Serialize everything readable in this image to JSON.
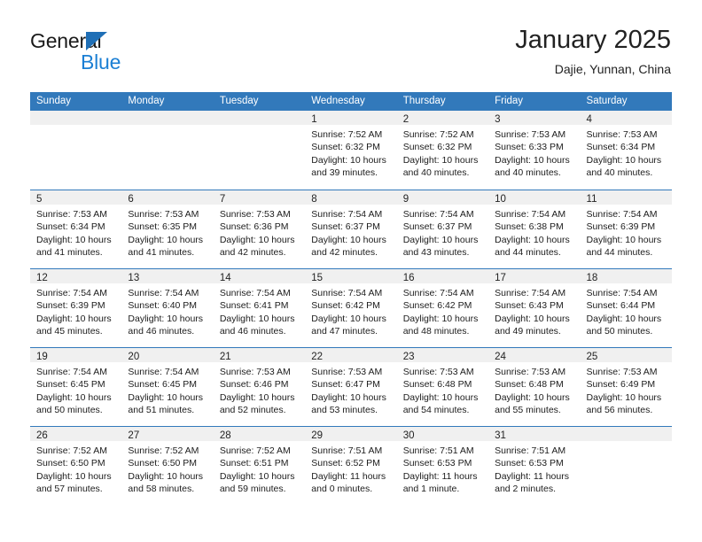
{
  "brand": {
    "name_top": "General",
    "name_bottom": "Blue",
    "triangle_color": "#1f6fb6",
    "blue_color": "#1b7fd4"
  },
  "header": {
    "title": "January 2025",
    "subtitle": "Dajie, Yunnan, China"
  },
  "theme": {
    "header_band": "#3279bb",
    "day_band": "#f0f0f0",
    "week_divider": "#3279bb"
  },
  "weekday_headers": [
    "Sunday",
    "Monday",
    "Tuesday",
    "Wednesday",
    "Thursday",
    "Friday",
    "Saturday"
  ],
  "weeks": [
    [
      {
        "day": "",
        "empty": true,
        "sunrise": "",
        "sunset": "",
        "daylight_line1": "",
        "daylight_line2": ""
      },
      {
        "day": "",
        "empty": true,
        "sunrise": "",
        "sunset": "",
        "daylight_line1": "",
        "daylight_line2": ""
      },
      {
        "day": "",
        "empty": true,
        "sunrise": "",
        "sunset": "",
        "daylight_line1": "",
        "daylight_line2": ""
      },
      {
        "day": "1",
        "sunrise": "Sunrise: 7:52 AM",
        "sunset": "Sunset: 6:32 PM",
        "daylight_line1": "Daylight: 10 hours",
        "daylight_line2": "and 39 minutes."
      },
      {
        "day": "2",
        "sunrise": "Sunrise: 7:52 AM",
        "sunset": "Sunset: 6:32 PM",
        "daylight_line1": "Daylight: 10 hours",
        "daylight_line2": "and 40 minutes."
      },
      {
        "day": "3",
        "sunrise": "Sunrise: 7:53 AM",
        "sunset": "Sunset: 6:33 PM",
        "daylight_line1": "Daylight: 10 hours",
        "daylight_line2": "and 40 minutes."
      },
      {
        "day": "4",
        "sunrise": "Sunrise: 7:53 AM",
        "sunset": "Sunset: 6:34 PM",
        "daylight_line1": "Daylight: 10 hours",
        "daylight_line2": "and 40 minutes."
      }
    ],
    [
      {
        "day": "5",
        "sunrise": "Sunrise: 7:53 AM",
        "sunset": "Sunset: 6:34 PM",
        "daylight_line1": "Daylight: 10 hours",
        "daylight_line2": "and 41 minutes."
      },
      {
        "day": "6",
        "sunrise": "Sunrise: 7:53 AM",
        "sunset": "Sunset: 6:35 PM",
        "daylight_line1": "Daylight: 10 hours",
        "daylight_line2": "and 41 minutes."
      },
      {
        "day": "7",
        "sunrise": "Sunrise: 7:53 AM",
        "sunset": "Sunset: 6:36 PM",
        "daylight_line1": "Daylight: 10 hours",
        "daylight_line2": "and 42 minutes."
      },
      {
        "day": "8",
        "sunrise": "Sunrise: 7:54 AM",
        "sunset": "Sunset: 6:37 PM",
        "daylight_line1": "Daylight: 10 hours",
        "daylight_line2": "and 42 minutes."
      },
      {
        "day": "9",
        "sunrise": "Sunrise: 7:54 AM",
        "sunset": "Sunset: 6:37 PM",
        "daylight_line1": "Daylight: 10 hours",
        "daylight_line2": "and 43 minutes."
      },
      {
        "day": "10",
        "sunrise": "Sunrise: 7:54 AM",
        "sunset": "Sunset: 6:38 PM",
        "daylight_line1": "Daylight: 10 hours",
        "daylight_line2": "and 44 minutes."
      },
      {
        "day": "11",
        "sunrise": "Sunrise: 7:54 AM",
        "sunset": "Sunset: 6:39 PM",
        "daylight_line1": "Daylight: 10 hours",
        "daylight_line2": "and 44 minutes."
      }
    ],
    [
      {
        "day": "12",
        "sunrise": "Sunrise: 7:54 AM",
        "sunset": "Sunset: 6:39 PM",
        "daylight_line1": "Daylight: 10 hours",
        "daylight_line2": "and 45 minutes."
      },
      {
        "day": "13",
        "sunrise": "Sunrise: 7:54 AM",
        "sunset": "Sunset: 6:40 PM",
        "daylight_line1": "Daylight: 10 hours",
        "daylight_line2": "and 46 minutes."
      },
      {
        "day": "14",
        "sunrise": "Sunrise: 7:54 AM",
        "sunset": "Sunset: 6:41 PM",
        "daylight_line1": "Daylight: 10 hours",
        "daylight_line2": "and 46 minutes."
      },
      {
        "day": "15",
        "sunrise": "Sunrise: 7:54 AM",
        "sunset": "Sunset: 6:42 PM",
        "daylight_line1": "Daylight: 10 hours",
        "daylight_line2": "and 47 minutes."
      },
      {
        "day": "16",
        "sunrise": "Sunrise: 7:54 AM",
        "sunset": "Sunset: 6:42 PM",
        "daylight_line1": "Daylight: 10 hours",
        "daylight_line2": "and 48 minutes."
      },
      {
        "day": "17",
        "sunrise": "Sunrise: 7:54 AM",
        "sunset": "Sunset: 6:43 PM",
        "daylight_line1": "Daylight: 10 hours",
        "daylight_line2": "and 49 minutes."
      },
      {
        "day": "18",
        "sunrise": "Sunrise: 7:54 AM",
        "sunset": "Sunset: 6:44 PM",
        "daylight_line1": "Daylight: 10 hours",
        "daylight_line2": "and 50 minutes."
      }
    ],
    [
      {
        "day": "19",
        "sunrise": "Sunrise: 7:54 AM",
        "sunset": "Sunset: 6:45 PM",
        "daylight_line1": "Daylight: 10 hours",
        "daylight_line2": "and 50 minutes."
      },
      {
        "day": "20",
        "sunrise": "Sunrise: 7:54 AM",
        "sunset": "Sunset: 6:45 PM",
        "daylight_line1": "Daylight: 10 hours",
        "daylight_line2": "and 51 minutes."
      },
      {
        "day": "21",
        "sunrise": "Sunrise: 7:53 AM",
        "sunset": "Sunset: 6:46 PM",
        "daylight_line1": "Daylight: 10 hours",
        "daylight_line2": "and 52 minutes."
      },
      {
        "day": "22",
        "sunrise": "Sunrise: 7:53 AM",
        "sunset": "Sunset: 6:47 PM",
        "daylight_line1": "Daylight: 10 hours",
        "daylight_line2": "and 53 minutes."
      },
      {
        "day": "23",
        "sunrise": "Sunrise: 7:53 AM",
        "sunset": "Sunset: 6:48 PM",
        "daylight_line1": "Daylight: 10 hours",
        "daylight_line2": "and 54 minutes."
      },
      {
        "day": "24",
        "sunrise": "Sunrise: 7:53 AM",
        "sunset": "Sunset: 6:48 PM",
        "daylight_line1": "Daylight: 10 hours",
        "daylight_line2": "and 55 minutes."
      },
      {
        "day": "25",
        "sunrise": "Sunrise: 7:53 AM",
        "sunset": "Sunset: 6:49 PM",
        "daylight_line1": "Daylight: 10 hours",
        "daylight_line2": "and 56 minutes."
      }
    ],
    [
      {
        "day": "26",
        "sunrise": "Sunrise: 7:52 AM",
        "sunset": "Sunset: 6:50 PM",
        "daylight_line1": "Daylight: 10 hours",
        "daylight_line2": "and 57 minutes."
      },
      {
        "day": "27",
        "sunrise": "Sunrise: 7:52 AM",
        "sunset": "Sunset: 6:50 PM",
        "daylight_line1": "Daylight: 10 hours",
        "daylight_line2": "and 58 minutes."
      },
      {
        "day": "28",
        "sunrise": "Sunrise: 7:52 AM",
        "sunset": "Sunset: 6:51 PM",
        "daylight_line1": "Daylight: 10 hours",
        "daylight_line2": "and 59 minutes."
      },
      {
        "day": "29",
        "sunrise": "Sunrise: 7:51 AM",
        "sunset": "Sunset: 6:52 PM",
        "daylight_line1": "Daylight: 11 hours",
        "daylight_line2": "and 0 minutes."
      },
      {
        "day": "30",
        "sunrise": "Sunrise: 7:51 AM",
        "sunset": "Sunset: 6:53 PM",
        "daylight_line1": "Daylight: 11 hours",
        "daylight_line2": "and 1 minute."
      },
      {
        "day": "31",
        "sunrise": "Sunrise: 7:51 AM",
        "sunset": "Sunset: 6:53 PM",
        "daylight_line1": "Daylight: 11 hours",
        "daylight_line2": "and 2 minutes."
      },
      {
        "day": "",
        "empty": true,
        "sunrise": "",
        "sunset": "",
        "daylight_line1": "",
        "daylight_line2": ""
      }
    ]
  ]
}
